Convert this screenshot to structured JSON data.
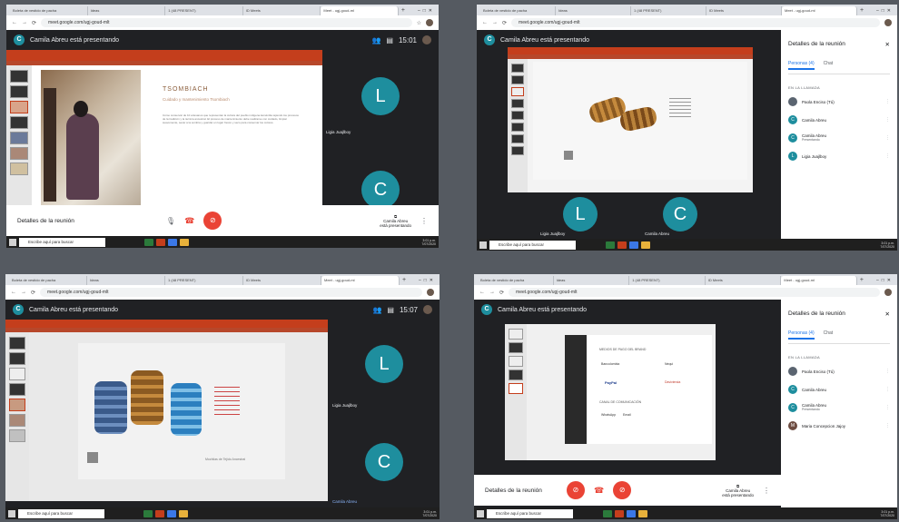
{
  "tabs": [
    "Boleta de vestido de pacha",
    "Ideas",
    "1 (48 PRESENT)",
    "ID Meets",
    "Meet - ugj-goud-ml",
    "+"
  ],
  "url": "meet.google.com/ugj-goud-mlt",
  "presenter_initial": "C",
  "presenting_title": "Camila Abreu está presentando",
  "times": {
    "top_left": "15:01",
    "bottom_left": "15:07"
  },
  "meeting_details": "Detalles de la reunión",
  "presenter_tile_label": "Camila Abreu\nestá presentando",
  "ligia": {
    "initial": "L",
    "name": "Ligia Juajlboy"
  },
  "camila": {
    "initial": "C",
    "name": "Camila Abreu"
  },
  "taskbar_search": "Escribe aquí para buscar",
  "tray_time": "3:01 p.m.\n7/07/2020",
  "slide1": {
    "title": "TSOMBIACH",
    "subtitle": "Cuidado y mantenimiento Tsombiach",
    "body": "Cómo conservar de 10 artesanos que representan la cultura del pueblo indígena kamëntša tejiendo los procesos de la tradición y la técnica ancestral. El proceso de mantenimiento debe realizarse con cuidado, limpiar suavemente, secar a la sombra y guardar en lugar fresco y seco para conservar los colores."
  },
  "panel": {
    "title": "Detalles de la reunión",
    "tab_people_tr": "Personas (4)",
    "tab_people_br": "Personas (4)",
    "tab_chat": "Chat",
    "section": "EN LA LLAMADA",
    "people_tr": [
      {
        "name": "Paola Enciso (Tú)",
        "sub": "",
        "initial": "",
        "kind": "photo"
      },
      {
        "name": "Camila Abreu",
        "sub": "",
        "initial": "C",
        "kind": ""
      },
      {
        "name": "Camila Abreu",
        "sub": "Presentando",
        "initial": "C",
        "kind": ""
      },
      {
        "name": "Ligia Juajlboy",
        "sub": "",
        "initial": "L",
        "kind": ""
      }
    ],
    "people_br": [
      {
        "name": "Paola Enciso (Tú)",
        "sub": "",
        "initial": "",
        "kind": "photo"
      },
      {
        "name": "Camila Abreu",
        "sub": "",
        "initial": "C",
        "kind": ""
      },
      {
        "name": "Camila Abreu",
        "sub": "Presentando",
        "initial": "C",
        "kind": ""
      },
      {
        "name": "Maria Concepcion Jajoy",
        "sub": "",
        "initial": "M",
        "kind": "m"
      }
    ]
  },
  "slide4": {
    "heading": "MEDIOS DE PAGO DEL BRAND",
    "payments": [
      "Bancolombia",
      "PayPal",
      "Nequi",
      "Davivienda"
    ],
    "contact": "CANAL DE COMUNICACIÓN",
    "contacts": [
      "WhatsApp",
      "Email"
    ]
  },
  "slide3_caption": "Mochilas de Tejido Ancestral",
  "colors": {
    "accent": "#1e8e9e",
    "red": "#ea4335",
    "ppt": "#c43e1c"
  },
  "icons": [
    "people-icon",
    "chat-icon",
    "mic-icon",
    "hangup-icon",
    "present-icon",
    "more-icon",
    "close-icon"
  ]
}
